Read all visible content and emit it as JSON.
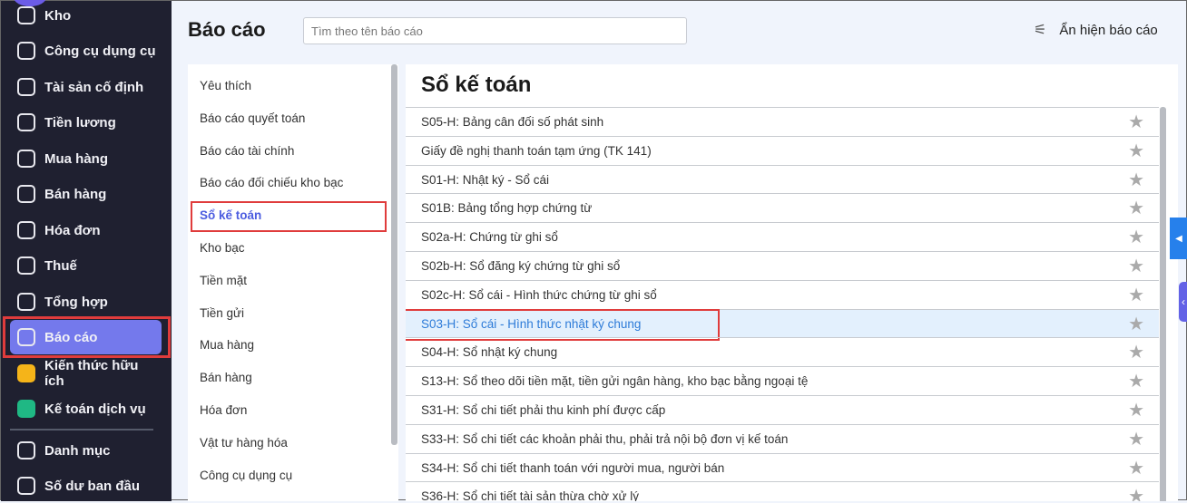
{
  "sidebar": {
    "items": [
      {
        "label": "Kho",
        "icon": "warehouse-icon"
      },
      {
        "label": "Công cụ dụng cụ",
        "icon": "tools-icon"
      },
      {
        "label": "Tài sản cố định",
        "icon": "truck-icon"
      },
      {
        "label": "Tiền lương",
        "icon": "salary-icon"
      },
      {
        "label": "Mua hàng",
        "icon": "cart-icon"
      },
      {
        "label": "Bán hàng",
        "icon": "store-icon"
      },
      {
        "label": "Hóa đơn",
        "icon": "invoice-icon"
      },
      {
        "label": "Thuế",
        "icon": "bank-icon"
      },
      {
        "label": "Tổng hợp",
        "icon": "book-icon"
      },
      {
        "label": "Báo cáo",
        "icon": "chart-icon"
      },
      {
        "label": "Kiến thức hữu ích",
        "icon": "knowledge-icon"
      },
      {
        "label": "Kế toán dịch vụ",
        "icon": "service-icon"
      },
      {
        "label": "Danh mục",
        "icon": "list-icon"
      },
      {
        "label": "Số dư ban đầu",
        "icon": "balance-icon"
      }
    ]
  },
  "header": {
    "title": "Báo cáo",
    "search_placeholder": "Tìm theo tên báo cáo",
    "toggle_label": "Ẩn hiện báo cáo"
  },
  "categories": [
    "Yêu thích",
    "Báo cáo quyết toán",
    "Báo cáo tài chính",
    "Báo cáo đối chiếu kho bạc",
    "Sổ kế toán",
    "Kho bạc",
    "Tiền mặt",
    "Tiền gửi",
    "Mua hàng",
    "Bán hàng",
    "Hóa đơn",
    "Vật tư hàng hóa",
    "Công cụ dụng cụ"
  ],
  "main": {
    "title": "Sổ kế toán",
    "reports": [
      "S05-H: Bảng cân đối số phát sinh",
      "Giấy đề nghị thanh toán tạm ứng (TK 141)",
      "S01-H: Nhật ký - Sổ cái",
      "S01B: Bảng tổng hợp chứng từ",
      "S02a-H: Chứng từ ghi sổ",
      "S02b-H: Sổ đăng ký chứng từ ghi sổ",
      "S02c-H: Sổ cái - Hình thức chứng từ ghi sổ",
      "S03-H: Sổ cái - Hình thức nhật ký chung",
      "S04-H: Sổ nhật ký chung",
      "S13-H: Sổ theo dõi tiền mặt, tiền gửi ngân hàng, kho bạc bằng ngoại tệ",
      "S31-H: Sổ chi tiết phải thu kinh phí được cấp",
      "S33-H: Sổ chi tiết các khoản phải thu, phải trả nội bộ đơn vị kế toán",
      "S34-H: Sổ chi tiết thanh toán với người mua, người bán",
      "S36-H: Sổ chi tiết tài sản thừa chờ xử lý"
    ]
  }
}
